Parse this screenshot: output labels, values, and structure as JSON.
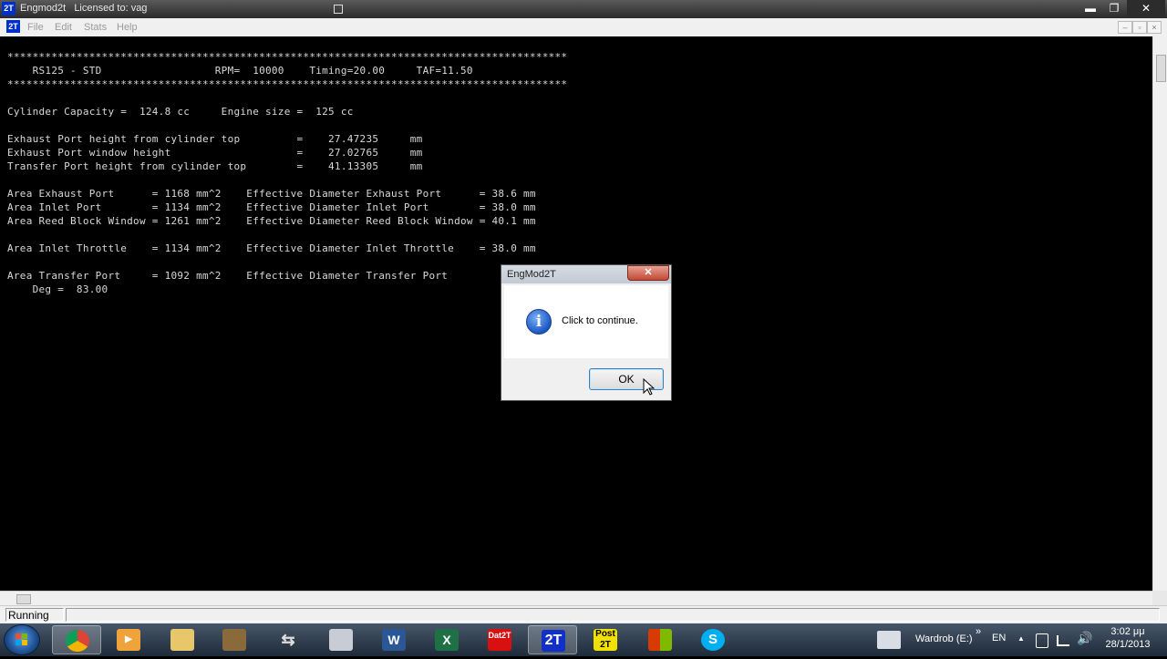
{
  "window": {
    "app_badge": "2T",
    "title": "Engmod2t   Licensed to: vag",
    "minimize": "▬",
    "maximize": "❐",
    "close": "✕"
  },
  "menu": {
    "items": [
      "File",
      "Edit",
      "Stats",
      "Help"
    ]
  },
  "console": {
    "lines": [
      "*****************************************************************************************",
      "    RS125 - STD                  RPM=  10000    Timing=20.00     TAF=11.50",
      "*****************************************************************************************",
      "",
      "Cylinder Capacity =  124.8 cc     Engine size =  125 cc",
      "",
      "Exhaust Port height from cylinder top         =    27.47235     mm",
      "Exhaust Port window height                    =    27.02765     mm",
      "Transfer Port height from cylinder top        =    41.13305     mm",
      "",
      "Area Exhaust Port      = 1168 mm^2    Effective Diameter Exhaust Port      = 38.6 mm",
      "Area Inlet Port        = 1134 mm^2    Effective Diameter Inlet Port        = 38.0 mm",
      "Area Reed Block Window = 1261 mm^2    Effective Diameter Reed Block Window = 40.1 mm",
      "",
      "Area Inlet Throttle    = 1134 mm^2    Effective Diameter Inlet Throttle    = 38.0 mm",
      "",
      "Area Transfer Port     = 1092 mm^2    Effective Diameter Transfer Port",
      "    Deg =  83.00"
    ]
  },
  "status": {
    "text": "Running"
  },
  "dialog": {
    "title": "EngMod2T",
    "close": "✕",
    "icon": "info-icon",
    "icon_glyph": "i",
    "message": "Click to continue.",
    "ok_label": "OK"
  },
  "taskbar": {
    "apps": [
      {
        "name": "chrome",
        "label": ""
      },
      {
        "name": "media-player",
        "label": ""
      },
      {
        "name": "file-explorer",
        "label": ""
      },
      {
        "name": "app-tool",
        "label": ""
      },
      {
        "name": "app-arrows",
        "label": ""
      },
      {
        "name": "calculator",
        "label": ""
      },
      {
        "name": "word",
        "label": "W"
      },
      {
        "name": "excel",
        "label": "X"
      },
      {
        "name": "dat2t",
        "label": "Dat2T"
      },
      {
        "name": "engmod2t",
        "label": "2T"
      },
      {
        "name": "post2t",
        "label": "Post 2T"
      },
      {
        "name": "office",
        "label": ""
      },
      {
        "name": "skype",
        "label": "S"
      }
    ],
    "toolbar_label": "Wardrob (E:)",
    "chevrons": "»",
    "language": "EN",
    "tray_arrow": "▲",
    "time": "3:02 μμ",
    "date": "28/1/2013"
  }
}
